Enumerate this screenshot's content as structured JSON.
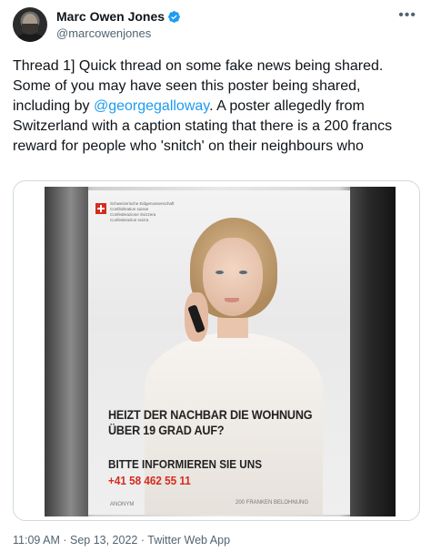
{
  "author": {
    "name": "Marc Owen Jones",
    "handle": "@marcowenjones",
    "verified": true,
    "avatar_icon": "avatar-icon"
  },
  "tweet": {
    "text_before_mention": "Thread 1]  Quick thread on some fake news being shared. Some of you may have seen this poster being shared, including by ",
    "mention": "@georgegalloway",
    "text_after_mention": ". A poster allegedly from Switzerland with a caption stating that there is a 200 francs reward for people who 'snitch' on their neighbours who"
  },
  "poster": {
    "agency_lines": [
      "Schweizerische Eidgenossenschaft",
      "Confédération suisse",
      "Confederazione Svizzera",
      "Confederaziun svizra"
    ],
    "headline_line1": "HEIZT DER NACHBAR DIE WOHNUNG",
    "headline_line2": "ÜBER 19 GRAD AUF?",
    "cta": "BITTE INFORMIEREN SIE UNS",
    "phone": "+41 58 462 55 11",
    "anon": "ANONYM",
    "reward": "200 FRANKEN BELOHNUNG"
  },
  "meta": {
    "timestamp": "11:09 AM · Sep 13, 2022 · Twitter Web App"
  },
  "colors": {
    "accent": "#1d9bf0",
    "swiss_red": "#d52b1e"
  },
  "icons": {
    "more": "more-options-icon",
    "verified": "verified-badge-icon"
  }
}
